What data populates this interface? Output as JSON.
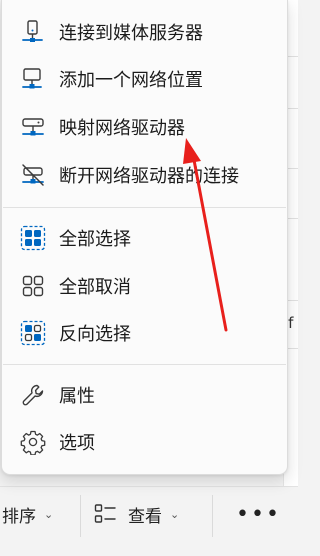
{
  "menu": {
    "items": [
      {
        "label": "连接到媒体服务器",
        "icon": "media-server-icon"
      },
      {
        "label": "添加一个网络位置",
        "icon": "network-location-icon"
      },
      {
        "label": "映射网络驱动器",
        "icon": "map-network-drive-icon"
      },
      {
        "label": "断开网络驱动器的连接",
        "icon": "disconnect-network-drive-icon"
      },
      {
        "label": "全部选择",
        "icon": "select-all-icon"
      },
      {
        "label": "全部取消",
        "icon": "select-none-icon"
      },
      {
        "label": "反向选择",
        "icon": "invert-selection-icon"
      },
      {
        "label": "属性",
        "icon": "wrench-icon"
      },
      {
        "label": "选项",
        "icon": "gear-icon"
      }
    ]
  },
  "commandbar": {
    "sort_label": "排序",
    "view_label": "查看",
    "more_label": "•••"
  },
  "background": {
    "partial_text": "if"
  },
  "colors": {
    "accent": "#0067c0",
    "annotation": "#e8201c"
  }
}
